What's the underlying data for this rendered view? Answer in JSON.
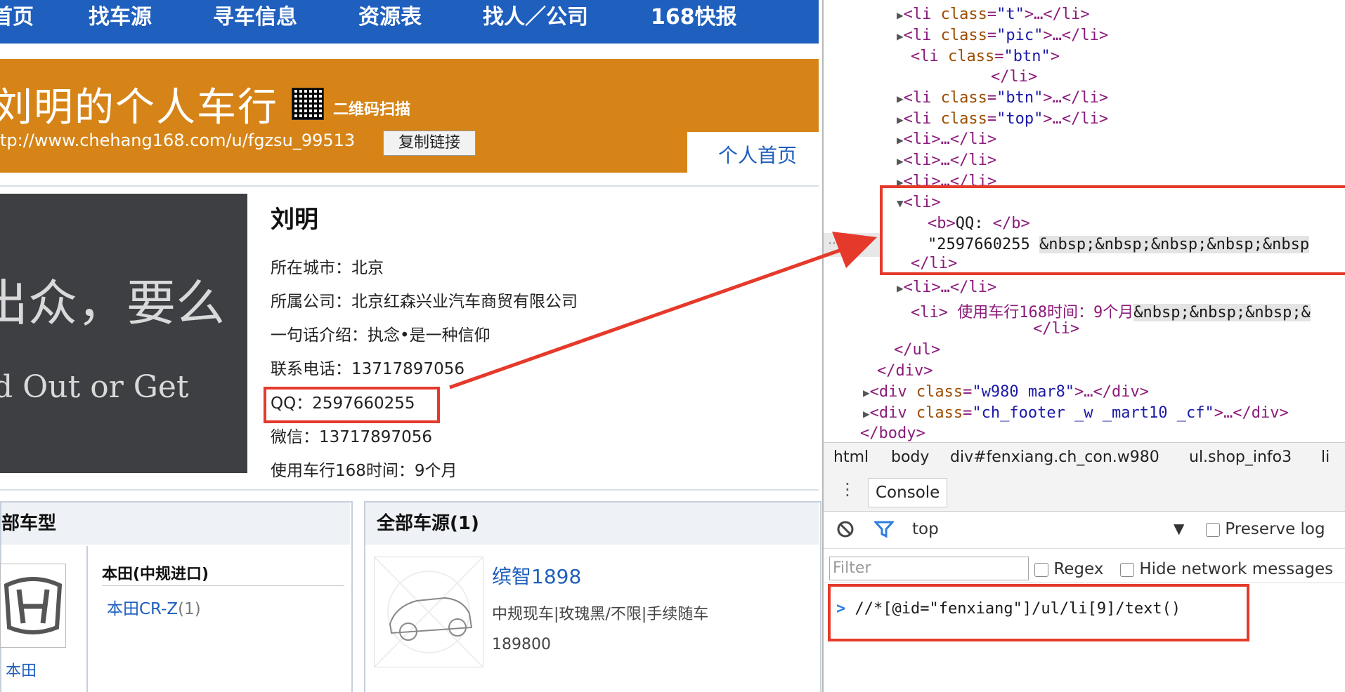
{
  "site": {
    "nav": [
      "首页",
      "找车源",
      "寻车信息",
      "资源表",
      "找人／公司",
      "168快报"
    ],
    "shop_title": "刘明的个人车行",
    "qr_label": "二维码扫描",
    "url": "tp://www.chehang168.com/u/fgzsu_99513",
    "copy_btn": "复制链接",
    "home_tab": "个人首页",
    "photo_text_cn": "出众，要么",
    "photo_text_en": "d  Out  or  Get",
    "name": "刘明",
    "info": {
      "city": "所在城市：北京",
      "company": "所属公司：北京红森兴业汽车商贸有限公司",
      "intro": "一句话介绍：执念•是一种信仰",
      "phone": "联系电话：13717897056",
      "qq": "QQ：2597660255",
      "wechat": "微信：13717897056",
      "usage": "使用车行168时间：9个月"
    },
    "models_panel": {
      "title": "部车型",
      "model_title": "本田(中规进口)",
      "model_link": "本田CR-Z",
      "model_count": "(1)",
      "brand": "本田"
    },
    "cars_panel": {
      "title": "全部车源(1)",
      "car_title": "缤智1898",
      "car_desc": "中规现车|玫瑰黑/不限|手续随车",
      "car_price": "189800"
    }
  },
  "devtools": {
    "lines": [
      {
        "indent": 6,
        "tri": "▶",
        "tag_open": "<li ",
        "attr": "class",
        "val": "\"t\"",
        "rest": ">…</li>"
      },
      {
        "indent": 6,
        "tri": "▶",
        "tag_open": "<li ",
        "attr": "class",
        "val": "\"pic\"",
        "rest": ">…</li>"
      },
      {
        "indent": 7,
        "tri": "",
        "tag_open": "<li ",
        "attr": "class",
        "val": "\"btn\"",
        "rest": ">"
      },
      {
        "indent": 12,
        "tri": "",
        "tag_open": "</li>",
        "attr": "",
        "val": "",
        "rest": ""
      },
      {
        "indent": 6,
        "tri": "▶",
        "tag_open": "<li ",
        "attr": "class",
        "val": "\"btn\"",
        "rest": ">…</li>"
      },
      {
        "indent": 6,
        "tri": "▶",
        "tag_open": "<li ",
        "attr": "class",
        "val": "\"top\"",
        "rest": ">…</li>"
      },
      {
        "indent": 6,
        "tri": "▶",
        "tag_open": "<li>…</li>",
        "attr": "",
        "val": "",
        "rest": ""
      },
      {
        "indent": 6,
        "tri": "▶",
        "tag_open": "<li>…</li>",
        "attr": "",
        "val": "",
        "rest": ""
      },
      {
        "indent": 6,
        "tri": "▶",
        "tag_open": "<li>…</li>",
        "attr": "",
        "val": "",
        "rest": ""
      },
      {
        "indent": 6,
        "tri": "▼",
        "tag_open": "<li>",
        "attr": "",
        "val": "",
        "rest": ""
      }
    ],
    "li_b": "QQ: ",
    "li_text": "\"2597660255 ",
    "li_ent": "&nbsp;&nbsp;&nbsp;&nbsp;&nbsp",
    "li_close": "</li>",
    "after_lines": [
      {
        "indent": 6,
        "tri": "▶",
        "text": "<li>…</li>"
      },
      {
        "indent": 7,
        "tri": "",
        "text": "<li> 使用车行168时间：9个月",
        "ent": "&nbsp;&nbsp;&nbsp;&"
      },
      {
        "indent": 13,
        "tri": "",
        "text": "</li>"
      },
      {
        "indent": 5,
        "tri": "",
        "text": "</ul>"
      },
      {
        "indent": 4,
        "tri": "",
        "text": "</div>"
      }
    ],
    "div_lines": [
      {
        "tri": "▶",
        "attr": "class",
        "val": "\"w980 mar8\"",
        "rest": ">…</div>"
      },
      {
        "tri": "▶",
        "attr": "class",
        "val": "\"ch_footer _w _mart10 _cf\"",
        "rest": ">…</div>"
      }
    ],
    "body_close": "</body>",
    "breadcrumbs": [
      "html",
      "body",
      "div#fenxiang.ch_con.w980",
      "ul.shop_info3",
      "li"
    ],
    "console_tab": "Console",
    "context": "top",
    "preserve_log": "Preserve log",
    "filter_placeholder": "Filter",
    "regex": "Regex",
    "hide_network": "Hide network messages",
    "command": "//*[@id=\"fenxiang\"]/ul/li[9]/text()"
  },
  "colors": {
    "nav": "#1f5fbd",
    "banner": "#d68418",
    "highlight": "#e53a2b"
  }
}
